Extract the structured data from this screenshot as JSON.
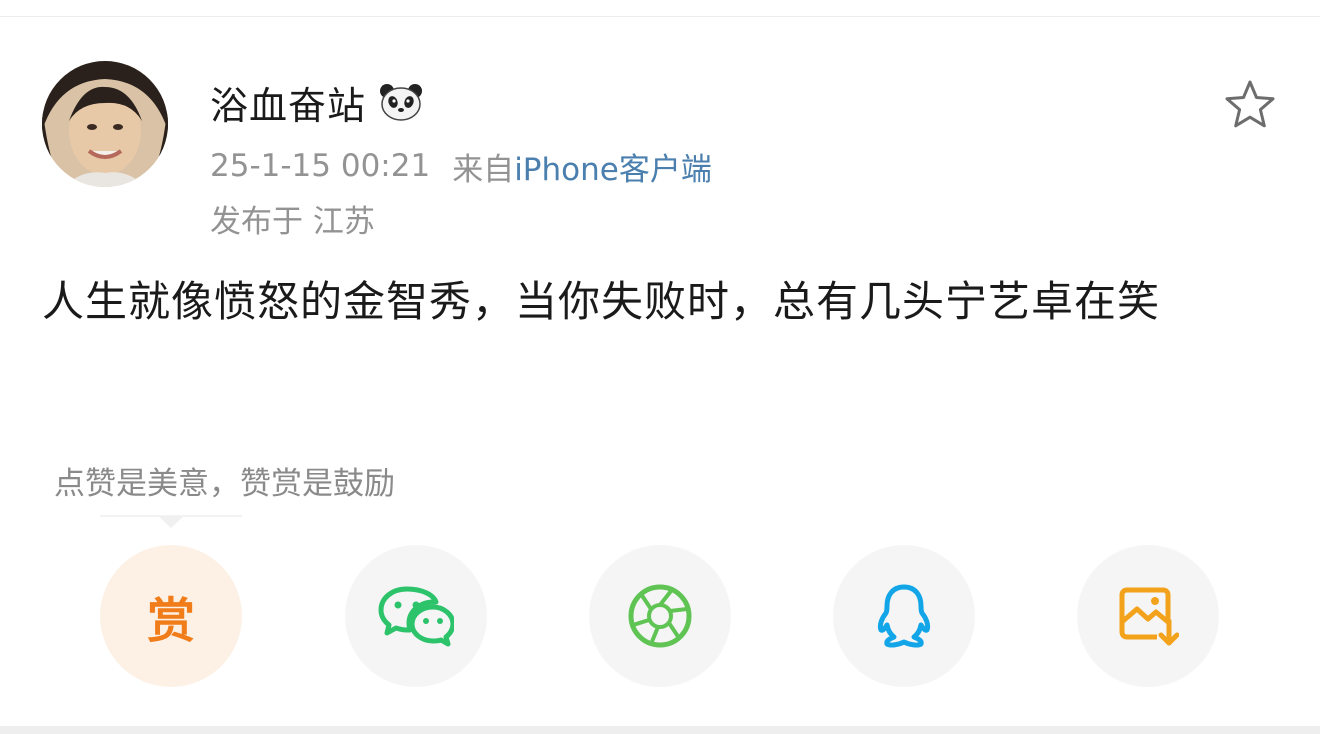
{
  "post": {
    "author": "浴血奋站",
    "author_badge_icon": "panda-icon",
    "timestamp": "25-1-15 00:21",
    "source_prefix": "来自",
    "source_client": "iPhone客户端",
    "location": "发布于 江苏",
    "text": "人生就像愤怒的金智秀，当你失败时，总有几头宁艺卓在笑"
  },
  "actions": {
    "tip": "点赞是美意，赞赏是鼓励",
    "reward_label": "赏",
    "items": [
      {
        "name": "reward",
        "icon": "reward-icon",
        "color": "#f07d1a"
      },
      {
        "name": "wechat",
        "icon": "wechat-icon",
        "color": "#2cc36b"
      },
      {
        "name": "moments",
        "icon": "wechat-moments-icon",
        "color": "#5fc453"
      },
      {
        "name": "qq",
        "icon": "qq-icon",
        "color": "#12a6e8"
      },
      {
        "name": "save-image",
        "icon": "save-image-icon",
        "color": "#f3a21b"
      }
    ]
  },
  "colors": {
    "text_primary": "#1a1a1a",
    "text_secondary": "#939393",
    "link": "#4a7fae"
  },
  "favorite_icon": "star-icon"
}
